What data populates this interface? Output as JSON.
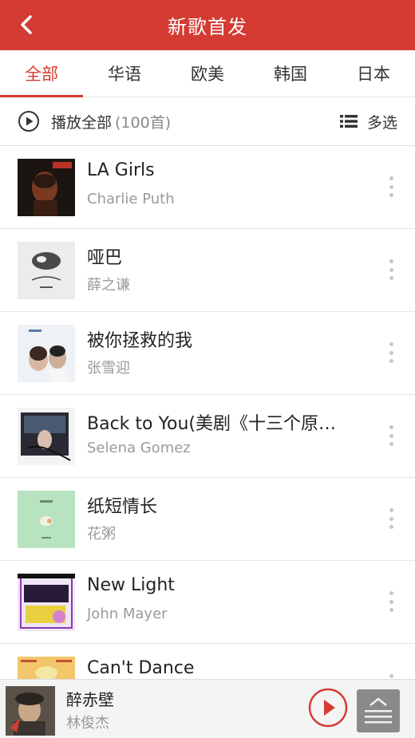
{
  "header": {
    "title": "新歌首发"
  },
  "tabs": [
    {
      "label": "全部",
      "active": true
    },
    {
      "label": "华语",
      "active": false
    },
    {
      "label": "欧美",
      "active": false
    },
    {
      "label": "韩国",
      "active": false
    },
    {
      "label": "日本",
      "active": false
    }
  ],
  "toolbar": {
    "play_all_label": "播放全部",
    "play_all_count": "(100首)",
    "multi_select_label": "多选"
  },
  "songs": [
    {
      "title": "LA Girls",
      "artist": "Charlie Puth"
    },
    {
      "title": "哑巴",
      "artist": "薛之谦"
    },
    {
      "title": "被你拯救的我",
      "artist": "张雪迎"
    },
    {
      "title": "Back to You(美剧《十三个原…",
      "artist": "Selena Gomez"
    },
    {
      "title": "纸短情长",
      "artist": "花粥"
    },
    {
      "title": "New Light",
      "artist": "John Mayer"
    },
    {
      "title": "Can't Dance",
      "artist": ""
    }
  ],
  "player": {
    "title": "醉赤壁",
    "artist": "林俊杰"
  },
  "colors": {
    "accent": "#d43c33",
    "secondary_text": "#9a9a9a"
  }
}
